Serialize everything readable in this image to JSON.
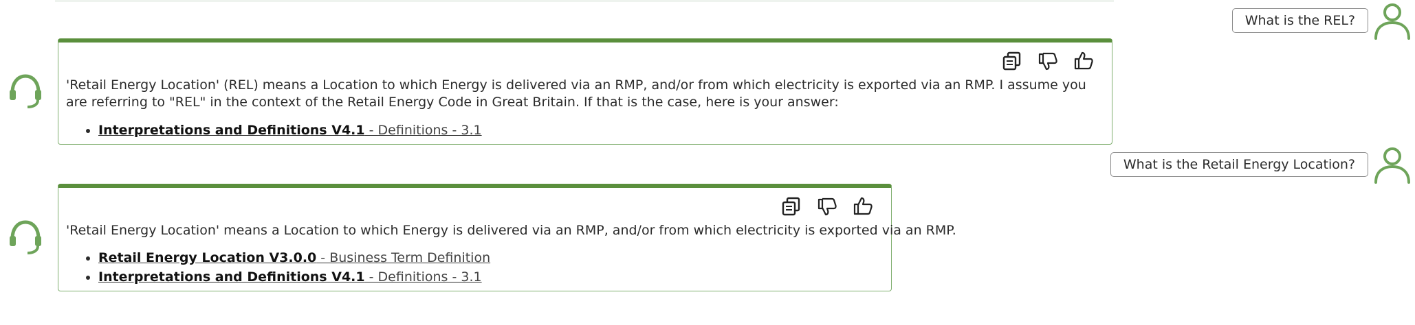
{
  "theme": {
    "accent": "#5a8f3c",
    "card_border": "#7dad6c",
    "icon_color": "#6ea45a"
  },
  "conversation": [
    {
      "user": {
        "question": "What is the REL?",
        "avatar_icon": "user-icon"
      },
      "bot": {
        "avatar_icon": "headset-icon",
        "answer": "'Retail Energy Location' (REL) means a Location to which Energy is delivered via an RMP, and/or from which electricity is exported via an RMP. I assume you are referring to \"REL\" in the context of the Retail Energy Code in Great Britain. If that is the case, here is your answer:",
        "actions": [
          "copy-icon",
          "thumbs-down-icon",
          "thumbs-up-icon"
        ],
        "references": [
          {
            "title": "Interpretations and Definitions V4.1",
            "detail": " - Definitions - 3.1"
          }
        ]
      }
    },
    {
      "user": {
        "question": "What is the Retail Energy Location?",
        "avatar_icon": "user-icon"
      },
      "bot": {
        "avatar_icon": "headset-icon",
        "answer": "'Retail Energy Location' means a Location to which Energy is delivered via an RMP, and/or from which electricity is exported via an RMP.",
        "actions": [
          "copy-icon",
          "thumbs-down-icon",
          "thumbs-up-icon"
        ],
        "references": [
          {
            "title": "Retail Energy Location V3.0.0",
            "detail": " - Business Term Definition"
          },
          {
            "title": "Interpretations and Definitions V4.1",
            "detail": " - Definitions - 3.1"
          }
        ]
      }
    }
  ]
}
